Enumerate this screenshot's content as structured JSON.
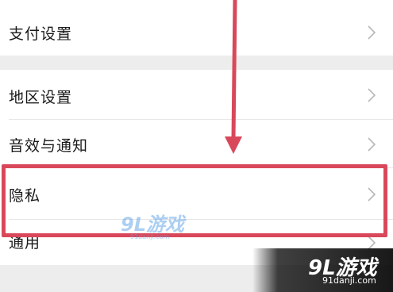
{
  "settings": {
    "items": [
      {
        "label": "支付设置"
      },
      {
        "label": "地区设置"
      },
      {
        "label": "音效与通知"
      },
      {
        "label": "隐私"
      },
      {
        "label": "通用"
      }
    ]
  },
  "annotation": {
    "arrow_color": "#d9485a",
    "highlight_color": "#d9485a",
    "highlighted_item": "隐私"
  },
  "watermark": {
    "brand": "9L游戏",
    "url": "91danji.com"
  },
  "icons": {
    "chevron": "chevron-right-icon"
  }
}
